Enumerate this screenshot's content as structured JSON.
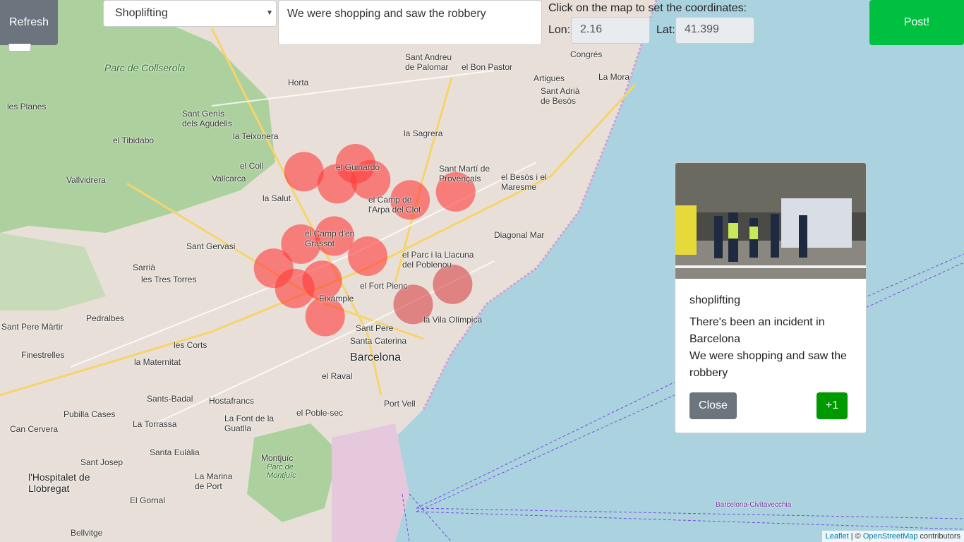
{
  "controls": {
    "refresh_label": "Refresh",
    "category_selected": "Shoplifting",
    "description_value": "We were shopping and saw the robbery",
    "coords_hint": "Click on the map to set the coordinates:",
    "lon_label": "Lon:",
    "lon_value": "2.16",
    "lat_label": "Lat:",
    "lat_value": "41.399",
    "post_label": "Post!"
  },
  "card": {
    "title": "shoplifting",
    "message": "There's been an incident in Barcelona",
    "description": "We were shopping and saw the robbery",
    "close_label": "Close",
    "plus_one_label": "+1"
  },
  "attribution": {
    "leaflet": "Leaflet",
    "separator": " | © ",
    "osm": "OpenStreetMap",
    "suffix": " contributors"
  },
  "map_labels": {
    "barcelona": "Barcelona",
    "parc_collserola": "Parc de Collserola",
    "horta": "Horta",
    "la_sagrera": "la Sagrera",
    "el_guinardo": "el Guinardó",
    "sant_marti": "Sant Martí de Provençals",
    "el_besos": "el Besòs i el Maresme",
    "diagonal_mar": "Diagonal Mar",
    "eixample": "Eixample",
    "sant_pere": "Sant Pere",
    "santa_caterina": "Santa Caterina",
    "el_raval": "el Raval",
    "el_poble_sec": "el Poble-sec",
    "port_vell": "Port Vell",
    "les_corts": "les Corts",
    "la_maternitat": "la Maternitat",
    "sants": "Sants-Badal",
    "hostafrancs": "Hostafrancs",
    "la_salut": "la Salut",
    "vallcarca": "Vallcarca",
    "el_coll": "el Coll",
    "sant_gervasi": "Sant Gervasi",
    "sarria": "Sarrià",
    "les_tres_torres": "les Tres Torres",
    "pedralbes": "Pedralbes",
    "finestrelles": "Finestrelles",
    "sant_pere_martir": "Sant Pere Màrtir",
    "montjuic": "Montjuïc",
    "parc_montjuic": "Parc de Montjuïc",
    "la_vila_olimpica": "la Vila Olímpica",
    "el_parc": "el Parc i la Llacuna del Poblenou",
    "el_fort_pienc": "el Fort Pienc",
    "el_camp_grassot": "el Camp d'en Grassot",
    "el_camp_arpa": "el Camp de l'Arpa del Clot",
    "sant_andreu": "Sant Andreu de Palomar",
    "el_bon_pastor": "el Bon Pastor",
    "sant_adria": "Sant Adrià de Besòs",
    "la_mora": "La Mora",
    "congres": "Congrés",
    "artigues": "Artigues",
    "la_teixonera": "la Teixonera",
    "sant_genis": "Sant Genís dels Agudells",
    "les_planes": "les Planes",
    "el_tibidabo": "el Tibidabo",
    "vallvidrera": "Vallvidrera",
    "hospitalet": "l'Hospitalet de Llobregat",
    "la_torrassa": "La Torrassa",
    "santa_eulalia": "Santa Eulàlia",
    "la_marina": "La Marina de Port",
    "sant_josep": "Sant Josep",
    "el_gornal": "El Gornal",
    "bellvitge": "Bellvitge",
    "pubilla_cases": "Pubilla Cases",
    "can_cervera": "Can Cervera",
    "la_font_guatlla": "La Font de la Guatlla",
    "barcelona_civitavecchia": "Barcelona-Civitavecchia"
  },
  "incidents": [
    {
      "lon": 2.164,
      "lat": 41.414
    },
    {
      "lon": 2.181,
      "lat": 41.416
    },
    {
      "lon": 2.175,
      "lat": 41.411
    },
    {
      "lon": 2.186,
      "lat": 41.412
    },
    {
      "lon": 2.199,
      "lat": 41.407
    },
    {
      "lon": 2.214,
      "lat": 41.409
    },
    {
      "lon": 2.163,
      "lat": 41.396
    },
    {
      "lon": 2.174,
      "lat": 41.398
    },
    {
      "lon": 2.185,
      "lat": 41.393
    },
    {
      "lon": 2.154,
      "lat": 41.39
    },
    {
      "lon": 2.161,
      "lat": 41.385
    },
    {
      "lon": 2.17,
      "lat": 41.387
    },
    {
      "lon": 2.171,
      "lat": 41.378
    },
    {
      "lon": 2.2,
      "lat": 41.381
    },
    {
      "lon": 2.213,
      "lat": 41.386
    }
  ],
  "colors": {
    "marker_fill": "#ff3b3b",
    "marker_fill_sea": "#d9444a",
    "sea": "#aad3df",
    "park": "#add19e",
    "urban": "#e8e0d8"
  }
}
